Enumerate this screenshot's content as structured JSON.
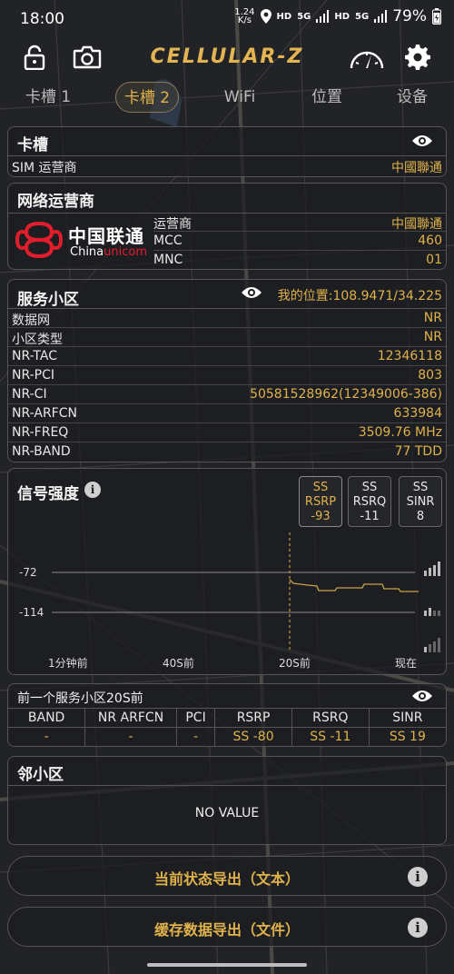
{
  "status": {
    "time": "18:00",
    "net_speed": "1.24",
    "net_speed_unit": "K/s",
    "hd1": "HD",
    "net1": "5G",
    "hd2": "HD",
    "net2": "5G",
    "battery": "79%"
  },
  "app": {
    "logo_text": "CELLULAR-Z"
  },
  "tabs": [
    "卡槽 1",
    "卡槽 2",
    "WiFi",
    "位置",
    "设备"
  ],
  "sim_panel": {
    "title": "卡槽",
    "row_key": "SIM 运营商",
    "row_value": "中國聯通"
  },
  "operator_panel": {
    "title": "网络运营商",
    "logo_cn": "中国联通",
    "logo_en_prefix": "China",
    "logo_en_suffix": "unicom",
    "rows": [
      {
        "k": "运营商",
        "v": "中國聯通"
      },
      {
        "k": "MCC",
        "v": "460"
      },
      {
        "k": "MNC",
        "v": "01"
      }
    ]
  },
  "cell_panel": {
    "title": "服务小区",
    "location": "我的位置:108.9471/34.225",
    "rows": [
      {
        "k": "数据网",
        "v": "NR"
      },
      {
        "k": "小区类型",
        "v": "NR"
      },
      {
        "k": "NR-TAC",
        "v": "12346118"
      },
      {
        "k": "NR-PCI",
        "v": "803"
      },
      {
        "k": "NR-CI",
        "v": "50581528962(12349006-386)"
      },
      {
        "k": "NR-ARFCN",
        "v": "633984"
      },
      {
        "k": "NR-FREQ",
        "v": "3509.76 MHz"
      },
      {
        "k": "NR-BAND",
        "v": "77 TDD"
      }
    ]
  },
  "signal_panel": {
    "title": "信号强度",
    "metrics": [
      {
        "l1": "SS",
        "l2": "RSRP",
        "v": "-93"
      },
      {
        "l1": "SS",
        "l2": "RSRQ",
        "v": "-11"
      },
      {
        "l1": "SS",
        "l2": "SINR",
        "v": "8"
      }
    ],
    "y_labels": [
      "-72",
      "-114"
    ],
    "x_labels": [
      "1分钟前",
      "40S前",
      "20S前",
      "现在"
    ]
  },
  "prev_panel": {
    "title": "前一个服务小区20S前",
    "headers": [
      "BAND",
      "NR ARFCN",
      "PCI",
      "RSRP",
      "RSRQ",
      "SINR"
    ],
    "values": [
      "-",
      "-",
      "-",
      "SS -80",
      "SS -11",
      "SS 19"
    ]
  },
  "neighbor_panel": {
    "title": "邻小区",
    "empty": "NO VALUE"
  },
  "export": {
    "text_label": "当前状态导出（文本）",
    "file_label": "缓存数据导出（文件）"
  }
}
